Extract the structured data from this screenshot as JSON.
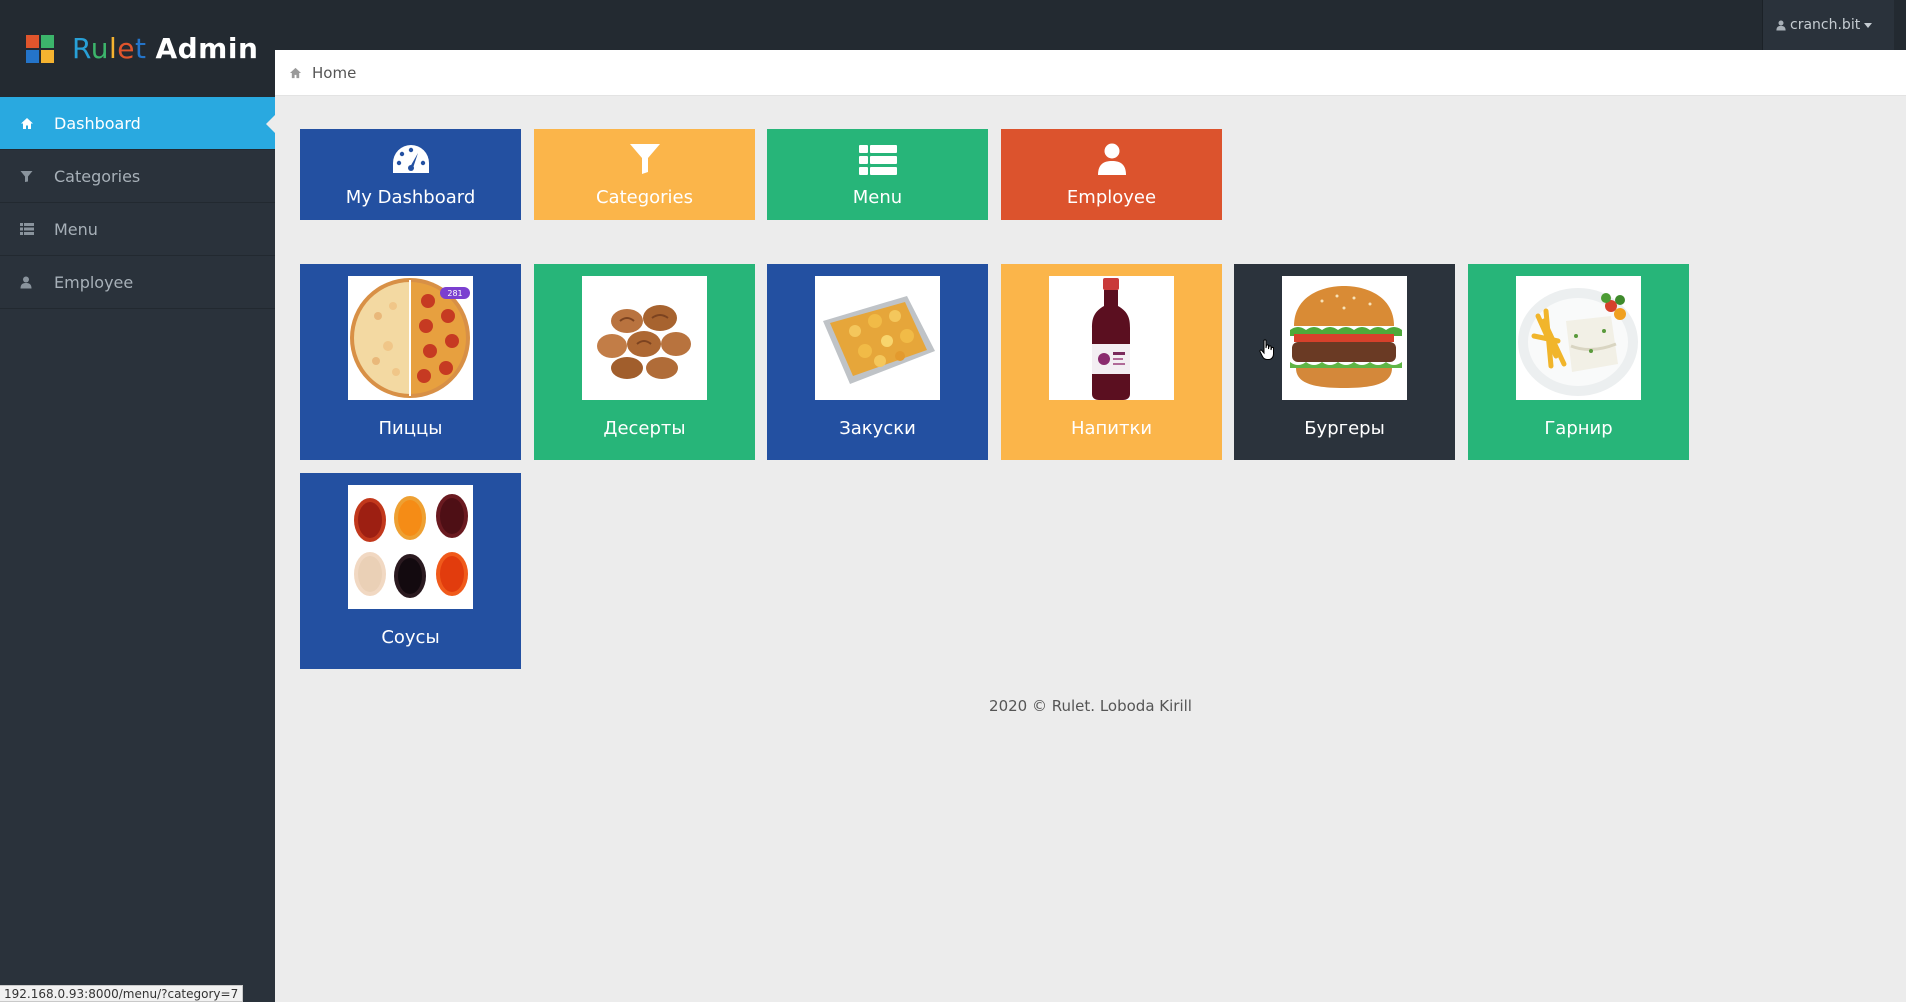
{
  "app": {
    "brand": {
      "first": [
        "R",
        "u",
        "l",
        "e",
        "t"
      ],
      "second": "Admin"
    },
    "logo_colors": [
      "#e0552c",
      "#3cb56b",
      "#2474c9",
      "#f5b330"
    ]
  },
  "sidebar": {
    "items": [
      {
        "label": "Dashboard",
        "icon": "home-icon",
        "active": true
      },
      {
        "label": "Categories",
        "icon": "filter-icon",
        "active": false
      },
      {
        "label": "Menu",
        "icon": "list-icon",
        "active": false
      },
      {
        "label": "Employee",
        "icon": "user-icon",
        "active": false
      }
    ]
  },
  "topbar": {
    "user": "cranch.bit"
  },
  "breadcrumb": {
    "home": "Home"
  },
  "quick_links": [
    {
      "label": "My Dashboard",
      "icon": "dashboard-gauge-icon",
      "color": "#2350a1"
    },
    {
      "label": "Categories",
      "icon": "filter-icon",
      "color": "#fbb54a"
    },
    {
      "label": "Menu",
      "icon": "list-icon",
      "color": "#27b579"
    },
    {
      "label": "Employee",
      "icon": "user-icon",
      "color": "#dc532d"
    }
  ],
  "categories": [
    {
      "label": "Пиццы",
      "image": "pizza",
      "color": "#2350a1",
      "badge": "281"
    },
    {
      "label": "Десерты",
      "image": "desserts",
      "color": "#27b579"
    },
    {
      "label": "Закуски",
      "image": "snacks",
      "color": "#2350a1"
    },
    {
      "label": "Напитки",
      "image": "drink",
      "color": "#fbb54a"
    },
    {
      "label": "Бургеры",
      "image": "burger",
      "color": "#2b333c"
    },
    {
      "label": "Гарнир",
      "image": "side-dish",
      "color": "#27b579"
    },
    {
      "label": "Соусы",
      "image": "sauces",
      "color": "#2350a1"
    }
  ],
  "footer": {
    "text": "2020 © Rulet. Loboda Kirill"
  },
  "status_bar": {
    "url": "192.168.0.93:8000/menu/?category=7"
  }
}
